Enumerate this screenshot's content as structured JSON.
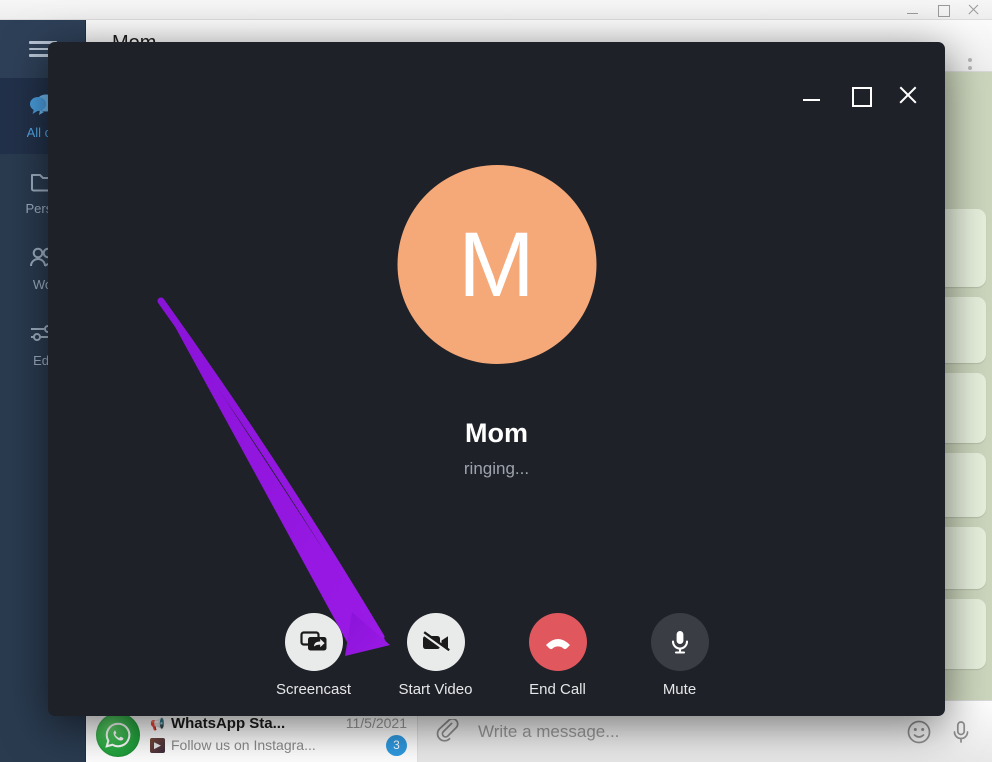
{
  "window": {
    "controls": [
      {
        "name": "minimize",
        "icon": "minimize-icon"
      },
      {
        "name": "maximize",
        "icon": "maximize-icon"
      },
      {
        "name": "close",
        "icon": "close-icon"
      }
    ]
  },
  "sidebar": {
    "menu_icon": "hamburger-menu-icon",
    "items": [
      {
        "label": "All ch",
        "icon": "chat-bubbles-icon",
        "active": true
      },
      {
        "label": "Perso",
        "icon": "folder-icon",
        "active": false
      },
      {
        "label": "Wo",
        "icon": "people-icon",
        "active": false
      },
      {
        "label": "Edi",
        "icon": "sliders-icon",
        "active": false
      }
    ]
  },
  "chat_header": {
    "title": "Mom",
    "menu_icon": "kebab-menu-icon"
  },
  "chat_list": {
    "row": {
      "avatar_icon": "whatsapp-logo-icon",
      "megaphone_icon": "megaphone-icon",
      "title": "WhatsApp Sta...",
      "date": "11/5/2021",
      "thumb_icon": "image-thumbnail-icon",
      "subtitle": "Follow us on Instagra...",
      "badge": "3"
    }
  },
  "composer": {
    "attach_icon": "paperclip-icon",
    "placeholder": "Write a message...",
    "value": "",
    "emoji_icon": "smiley-icon",
    "mic_icon": "microphone-icon"
  },
  "call_dialog": {
    "controls": [
      {
        "name": "minimize",
        "icon": "minimize-icon"
      },
      {
        "name": "maximize",
        "icon": "maximize-icon"
      },
      {
        "name": "close",
        "icon": "close-icon"
      }
    ],
    "avatar_initial": "M",
    "avatar_color": "#f5a878",
    "contact_name": "Mom",
    "status": "ringing...",
    "background_color": "#1e2128",
    "actions": [
      {
        "label": "Screencast",
        "icon": "screencast-icon",
        "style": "light"
      },
      {
        "label": "Start Video",
        "icon": "video-off-icon",
        "style": "light"
      },
      {
        "label": "End Call",
        "icon": "end-call-icon",
        "style": "danger"
      },
      {
        "label": "Mute",
        "icon": "microphone-icon",
        "style": "dark"
      }
    ]
  },
  "annotation": {
    "arrow_color": "#8f18e0",
    "points_at": "Screencast"
  }
}
